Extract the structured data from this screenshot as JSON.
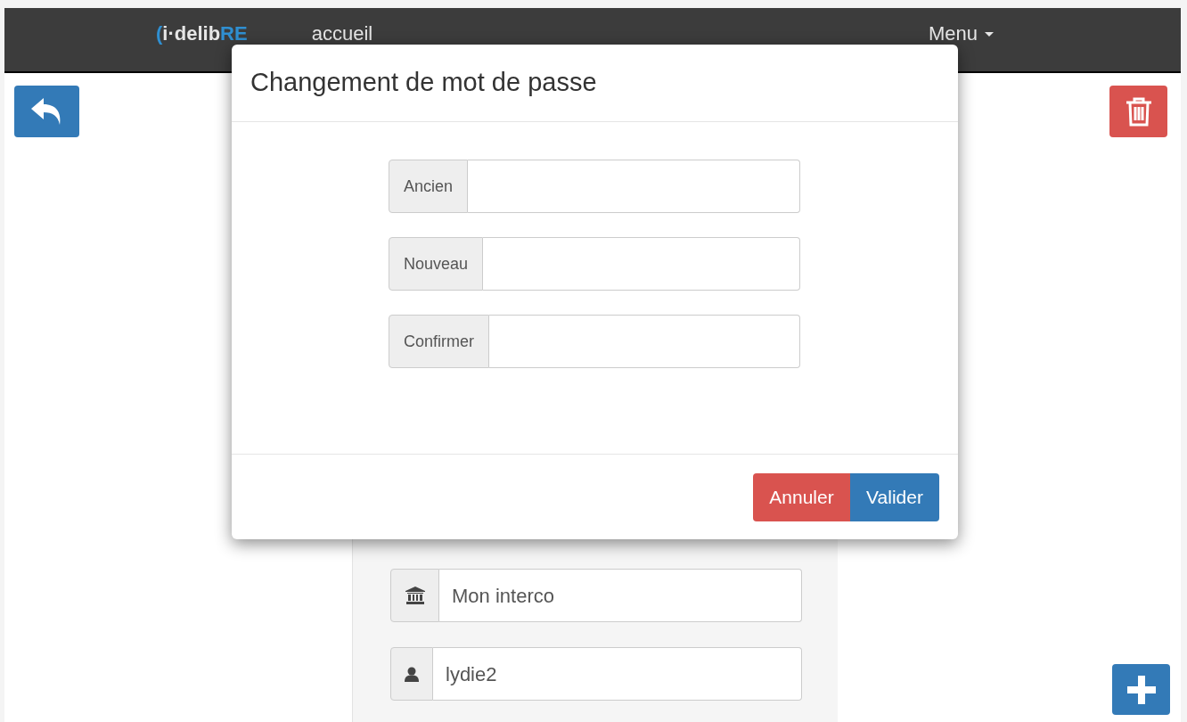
{
  "navbar": {
    "logo": {
      "prefix": "(",
      "main": "i·delib",
      "suffix": "RE"
    },
    "links": [
      {
        "label": "accueil"
      }
    ],
    "menu": {
      "label": "Menu"
    }
  },
  "page": {
    "fields": [
      {
        "kind": "institution",
        "value": "Mon interco"
      },
      {
        "kind": "user",
        "value": "lydie2"
      }
    ]
  },
  "modal": {
    "title": "Changement de mot de passe",
    "fields": [
      {
        "label": "Ancien"
      },
      {
        "label": "Nouveau"
      },
      {
        "label": "Confirmer"
      }
    ],
    "buttons": [
      {
        "kind": "danger",
        "label": "Annuler"
      },
      {
        "kind": "primary",
        "label": "Valider"
      }
    ]
  }
}
